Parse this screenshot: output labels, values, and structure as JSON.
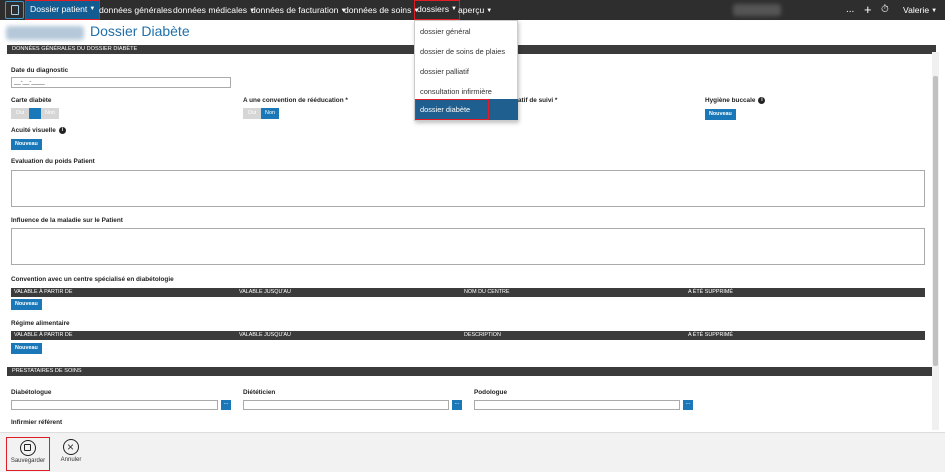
{
  "topbar": {
    "nav": [
      {
        "label": "Dossier patient"
      },
      {
        "label": "données générales"
      },
      {
        "label": "données médicales"
      },
      {
        "label": "données de facturation"
      },
      {
        "label": "données de soins"
      },
      {
        "label": "dossiers"
      },
      {
        "label": "aperçu"
      }
    ],
    "more": "...",
    "add": "+",
    "timer": "⏱",
    "user": "Valerie"
  },
  "page": {
    "title": "Dossier Diabète"
  },
  "sections": {
    "general": "DONNÉES GÉNÉRALES DU DOSSIER DIABÈTE",
    "providers": "PRESTATAIRES DE SOINS"
  },
  "fields": {
    "diagnosis_date": {
      "label": "Date du diagnostic",
      "value": "__-__-____"
    },
    "diabetes_card": {
      "label": "Carte diabète",
      "yes": "Oui",
      "no": "Non"
    },
    "rehab": {
      "label": "A une convention de rééducation *",
      "yes": "Oui",
      "no": "Non"
    },
    "followup": {
      "label": "atif de suivi *"
    },
    "oral_hygiene": {
      "label": "Hygiène buccale"
    },
    "visual_acuity": {
      "label": "Acuité visuelle"
    },
    "weight_eval": {
      "label": "Evaluation du poids Patient"
    },
    "disease_influence": {
      "label": "Influence de la maladie sur le Patient"
    },
    "convention": {
      "label": "Convention avec un centre spécialisé en diabétologie",
      "columns": [
        "VALABLE À PARTIR DE",
        "VALABLE JUSQU'AU",
        "NOM DU CENTRE",
        "A ÉTÉ SUPPRIMÉ"
      ]
    },
    "diet": {
      "label": "Régime alimentaire",
      "columns": [
        "VALABLE À PARTIR DE",
        "VALABLE JUSQU'AU",
        "DESCRIPTION",
        "A ÉTÉ SUPPRIMÉ"
      ]
    },
    "diabetologist": {
      "label": "Diabétologue"
    },
    "dietitian": {
      "label": "Diététicien"
    },
    "podologist": {
      "label": "Podologue"
    },
    "nurse": {
      "label": "Infirmier référent"
    }
  },
  "buttons": {
    "new": "Nouveau",
    "dots": "...",
    "info": "i"
  },
  "dropdown": {
    "items": [
      {
        "label": "dossier général"
      },
      {
        "label": "dossier de soins de plaies"
      },
      {
        "label": "dossier palliatif"
      },
      {
        "label": "consultation infirmière"
      },
      {
        "label": "dossier diabète"
      }
    ]
  },
  "bottombar": {
    "save": "Sauvegarder",
    "cancel": "Annuler"
  },
  "colors": {
    "accent": "#1b78b8",
    "nav_bg": "#2e2e2e",
    "highlight": "#e01c24"
  }
}
